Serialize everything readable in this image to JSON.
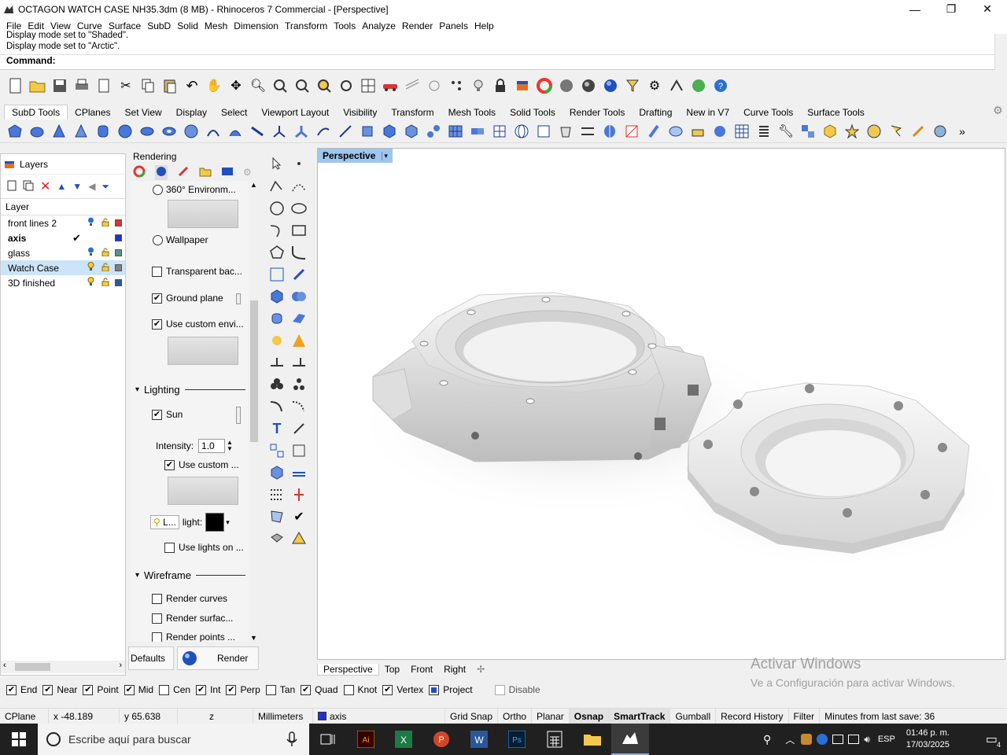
{
  "window": {
    "title": "OCTAGON WATCH CASE NH35.3dm (8 MB) - Rhinoceros 7 Commercial - [Perspective]",
    "minimize": "—",
    "maximize": "❐",
    "close": "✕"
  },
  "menu": [
    "File",
    "Edit",
    "View",
    "Curve",
    "Surface",
    "SubD",
    "Solid",
    "Mesh",
    "Dimension",
    "Transform",
    "Tools",
    "Analyze",
    "Render",
    "Panels",
    "Help"
  ],
  "command": {
    "history1": "Display mode set to \"Shaded\".",
    "history2": "Display mode set to \"Arctic\".",
    "prompt": "Command:"
  },
  "toolbar_tabs": [
    "SubD Tools",
    "CPlanes",
    "Set View",
    "Display",
    "Select",
    "Viewport Layout",
    "Visibility",
    "Transform",
    "Mesh Tools",
    "Solid Tools",
    "Render Tools",
    "Drafting",
    "New in V7",
    "Curve Tools",
    "Surface Tools"
  ],
  "layers": {
    "title": "Layers",
    "column": "Layer",
    "rows": [
      {
        "name": "front lines 2",
        "color": "#e03030",
        "bulb": "on",
        "lock": "open",
        "current": false,
        "selected": false
      },
      {
        "name": "axis",
        "color": "#1a2fe0",
        "bulb": "",
        "lock": "",
        "current": true,
        "selected": false
      },
      {
        "name": "glass",
        "color": "#5a8f8f",
        "bulb": "on",
        "lock": "open",
        "current": false,
        "selected": false
      },
      {
        "name": "Watch Case",
        "color": "#808080",
        "bulb": "on",
        "lock": "open",
        "current": false,
        "selected": true
      },
      {
        "name": "3D finished",
        "color": "#2a5a9a",
        "bulb": "on",
        "lock": "open",
        "current": false,
        "selected": false
      }
    ]
  },
  "rendering": {
    "title": "Rendering",
    "env360": "360° Environm...",
    "wallpaper": "Wallpaper",
    "transparent": "Transparent bac...",
    "ground_plane": "Ground plane",
    "use_custom_env": "Use custom envi...",
    "lighting": "Lighting",
    "sun": "Sun",
    "intensity_label": "Intensity:",
    "intensity_value": "1.0",
    "use_custom": "Use custom ...",
    "light_short": "L...",
    "light_label": "light:",
    "use_lights_on": "Use lights on ...",
    "wireframe": "Wireframe",
    "render_curves": "Render curves",
    "render_surfaces": "Render surfac...",
    "render_points": "Render points ...",
    "defaults": "Defaults",
    "render": "Render"
  },
  "viewport": {
    "name": "Perspective",
    "tabs": [
      "Perspective",
      "Top",
      "Front",
      "Right"
    ],
    "add_tab": "✢"
  },
  "activate": {
    "line1": "Activar Windows",
    "line2": "Ve a Configuración para activar Windows."
  },
  "osnap": [
    {
      "label": "End",
      "checked": true
    },
    {
      "label": "Near",
      "checked": true
    },
    {
      "label": "Point",
      "checked": true
    },
    {
      "label": "Mid",
      "checked": true
    },
    {
      "label": "Cen",
      "checked": false
    },
    {
      "label": "Int",
      "checked": true
    },
    {
      "label": "Perp",
      "checked": true
    },
    {
      "label": "Tan",
      "checked": false
    },
    {
      "label": "Quad",
      "checked": true
    },
    {
      "label": "Knot",
      "checked": false
    },
    {
      "label": "Vertex",
      "checked": true
    },
    {
      "label": "Project",
      "checked": true
    },
    {
      "label": "Disable",
      "checked": false
    }
  ],
  "status": {
    "cplane": "CPlane",
    "x": "x -48.189",
    "y": "y 65.638",
    "z": "z",
    "units": "Millimeters",
    "layer": "axis",
    "layer_color": "#1a2fe0",
    "grid_snap": "Grid Snap",
    "ortho": "Ortho",
    "planar": "Planar",
    "osnap": "Osnap",
    "smarttrack": "SmartTrack",
    "gumball": "Gumball",
    "record_history": "Record History",
    "filter": "Filter",
    "minutes": "Minutes from last save: 36"
  },
  "taskbar": {
    "search_placeholder": "Escribe aquí para buscar",
    "lang": "ESP",
    "time": "01:46 p. m.",
    "date": "17/03/2025",
    "notif_count": "4"
  }
}
